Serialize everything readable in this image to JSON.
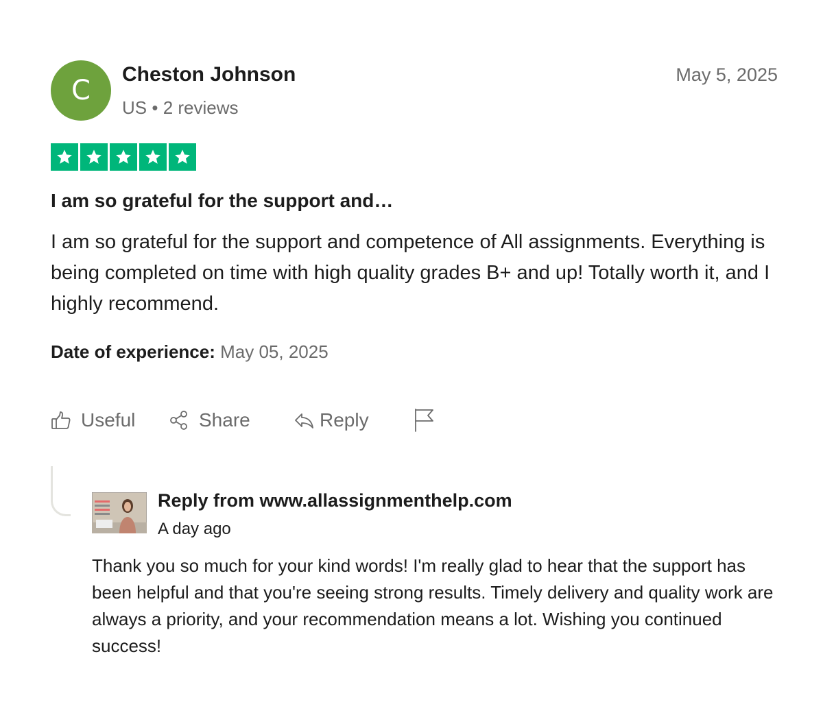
{
  "review": {
    "reviewer": {
      "initial": "C",
      "avatar_color": "#6ea23d",
      "name": "Cheston Johnson",
      "country": "US",
      "separator": "•",
      "review_count": "2 reviews"
    },
    "date": "May 5, 2025",
    "rating": 5,
    "rating_max": 5,
    "star_color": "#00b67a",
    "title": "I am so grateful for the support and…",
    "body": "I am so grateful for the support and competence of All assignments. Everything is being completed on time with high quality grades B+ and up! Totally worth it, and I highly recommend.",
    "experience_label": "Date of experience:",
    "experience_date": "May 05, 2025"
  },
  "actions": {
    "useful": {
      "label": "Useful",
      "icon": "thumbs-up-icon"
    },
    "share": {
      "label": "Share",
      "icon": "share-icon"
    },
    "reply": {
      "label": "Reply",
      "icon": "reply-arrow-icon"
    },
    "flag": {
      "icon": "flag-icon"
    }
  },
  "reply": {
    "author": "Reply from www.allassignmenthelp.com",
    "time": "A day ago",
    "body": "Thank you so much for your kind words! I'm really glad to hear that the support has been helpful and that you're seeing strong results. Timely delivery and quality work are always a priority, and your recommendation means a lot. Wishing you continued success!"
  }
}
